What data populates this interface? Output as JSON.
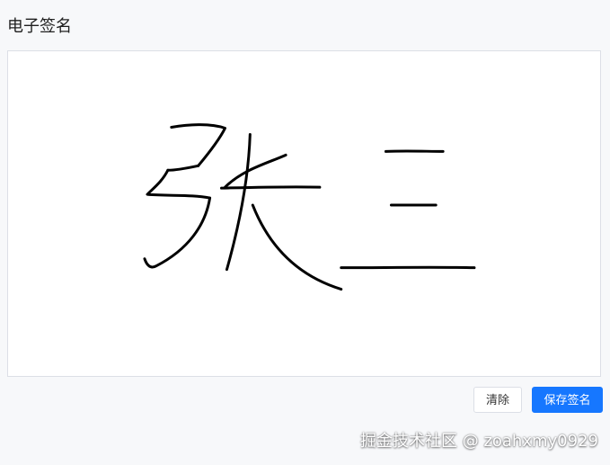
{
  "page": {
    "title": "电子签名"
  },
  "signature_pad": {
    "stroke_color": "#000000",
    "background": "#ffffff",
    "border_color": "#dcdfe6",
    "handwritten_text": "张三"
  },
  "actions": {
    "clear_label": "清除",
    "save_label": "保存签名",
    "primary_color": "#1677ff"
  },
  "watermark": {
    "text": "掘金技术社区 @ zoahxmy0929"
  }
}
